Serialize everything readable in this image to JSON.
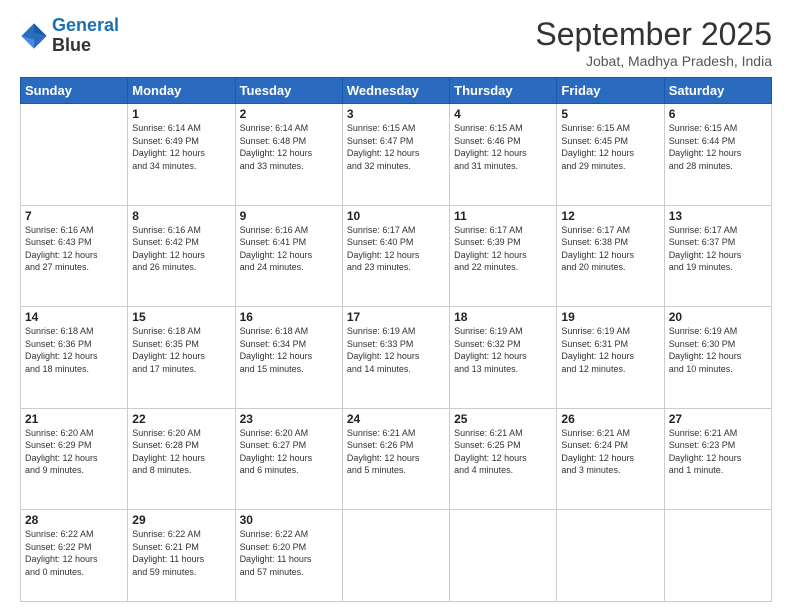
{
  "header": {
    "logo_line1": "General",
    "logo_line2": "Blue",
    "month_title": "September 2025",
    "location": "Jobat, Madhya Pradesh, India"
  },
  "days_of_week": [
    "Sunday",
    "Monday",
    "Tuesday",
    "Wednesday",
    "Thursday",
    "Friday",
    "Saturday"
  ],
  "weeks": [
    [
      {
        "day": "",
        "info": ""
      },
      {
        "day": "1",
        "info": "Sunrise: 6:14 AM\nSunset: 6:49 PM\nDaylight: 12 hours\nand 34 minutes."
      },
      {
        "day": "2",
        "info": "Sunrise: 6:14 AM\nSunset: 6:48 PM\nDaylight: 12 hours\nand 33 minutes."
      },
      {
        "day": "3",
        "info": "Sunrise: 6:15 AM\nSunset: 6:47 PM\nDaylight: 12 hours\nand 32 minutes."
      },
      {
        "day": "4",
        "info": "Sunrise: 6:15 AM\nSunset: 6:46 PM\nDaylight: 12 hours\nand 31 minutes."
      },
      {
        "day": "5",
        "info": "Sunrise: 6:15 AM\nSunset: 6:45 PM\nDaylight: 12 hours\nand 29 minutes."
      },
      {
        "day": "6",
        "info": "Sunrise: 6:15 AM\nSunset: 6:44 PM\nDaylight: 12 hours\nand 28 minutes."
      }
    ],
    [
      {
        "day": "7",
        "info": "Sunrise: 6:16 AM\nSunset: 6:43 PM\nDaylight: 12 hours\nand 27 minutes."
      },
      {
        "day": "8",
        "info": "Sunrise: 6:16 AM\nSunset: 6:42 PM\nDaylight: 12 hours\nand 26 minutes."
      },
      {
        "day": "9",
        "info": "Sunrise: 6:16 AM\nSunset: 6:41 PM\nDaylight: 12 hours\nand 24 minutes."
      },
      {
        "day": "10",
        "info": "Sunrise: 6:17 AM\nSunset: 6:40 PM\nDaylight: 12 hours\nand 23 minutes."
      },
      {
        "day": "11",
        "info": "Sunrise: 6:17 AM\nSunset: 6:39 PM\nDaylight: 12 hours\nand 22 minutes."
      },
      {
        "day": "12",
        "info": "Sunrise: 6:17 AM\nSunset: 6:38 PM\nDaylight: 12 hours\nand 20 minutes."
      },
      {
        "day": "13",
        "info": "Sunrise: 6:17 AM\nSunset: 6:37 PM\nDaylight: 12 hours\nand 19 minutes."
      }
    ],
    [
      {
        "day": "14",
        "info": "Sunrise: 6:18 AM\nSunset: 6:36 PM\nDaylight: 12 hours\nand 18 minutes."
      },
      {
        "day": "15",
        "info": "Sunrise: 6:18 AM\nSunset: 6:35 PM\nDaylight: 12 hours\nand 17 minutes."
      },
      {
        "day": "16",
        "info": "Sunrise: 6:18 AM\nSunset: 6:34 PM\nDaylight: 12 hours\nand 15 minutes."
      },
      {
        "day": "17",
        "info": "Sunrise: 6:19 AM\nSunset: 6:33 PM\nDaylight: 12 hours\nand 14 minutes."
      },
      {
        "day": "18",
        "info": "Sunrise: 6:19 AM\nSunset: 6:32 PM\nDaylight: 12 hours\nand 13 minutes."
      },
      {
        "day": "19",
        "info": "Sunrise: 6:19 AM\nSunset: 6:31 PM\nDaylight: 12 hours\nand 12 minutes."
      },
      {
        "day": "20",
        "info": "Sunrise: 6:19 AM\nSunset: 6:30 PM\nDaylight: 12 hours\nand 10 minutes."
      }
    ],
    [
      {
        "day": "21",
        "info": "Sunrise: 6:20 AM\nSunset: 6:29 PM\nDaylight: 12 hours\nand 9 minutes."
      },
      {
        "day": "22",
        "info": "Sunrise: 6:20 AM\nSunset: 6:28 PM\nDaylight: 12 hours\nand 8 minutes."
      },
      {
        "day": "23",
        "info": "Sunrise: 6:20 AM\nSunset: 6:27 PM\nDaylight: 12 hours\nand 6 minutes."
      },
      {
        "day": "24",
        "info": "Sunrise: 6:21 AM\nSunset: 6:26 PM\nDaylight: 12 hours\nand 5 minutes."
      },
      {
        "day": "25",
        "info": "Sunrise: 6:21 AM\nSunset: 6:25 PM\nDaylight: 12 hours\nand 4 minutes."
      },
      {
        "day": "26",
        "info": "Sunrise: 6:21 AM\nSunset: 6:24 PM\nDaylight: 12 hours\nand 3 minutes."
      },
      {
        "day": "27",
        "info": "Sunrise: 6:21 AM\nSunset: 6:23 PM\nDaylight: 12 hours\nand 1 minute."
      }
    ],
    [
      {
        "day": "28",
        "info": "Sunrise: 6:22 AM\nSunset: 6:22 PM\nDaylight: 12 hours\nand 0 minutes."
      },
      {
        "day": "29",
        "info": "Sunrise: 6:22 AM\nSunset: 6:21 PM\nDaylight: 11 hours\nand 59 minutes."
      },
      {
        "day": "30",
        "info": "Sunrise: 6:22 AM\nSunset: 6:20 PM\nDaylight: 11 hours\nand 57 minutes."
      },
      {
        "day": "",
        "info": ""
      },
      {
        "day": "",
        "info": ""
      },
      {
        "day": "",
        "info": ""
      },
      {
        "day": "",
        "info": ""
      }
    ]
  ]
}
